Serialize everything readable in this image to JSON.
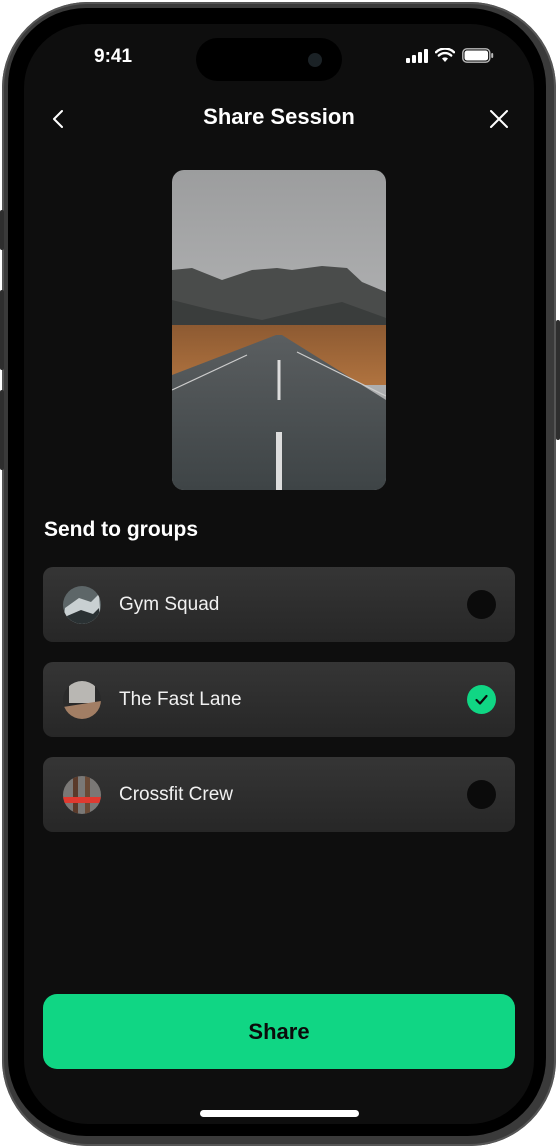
{
  "status_bar": {
    "time": "9:41",
    "icons": [
      "cellular-signal-icon",
      "wifi-icon",
      "battery-icon"
    ]
  },
  "nav": {
    "title": "Share Session",
    "back_icon": "chevron-left-icon",
    "close_icon": "close-icon"
  },
  "preview": {
    "description": "Road leading toward mountains under cloudy sky"
  },
  "groups_section": {
    "title": "Send to groups",
    "items": [
      {
        "name": "Gym Squad",
        "selected": false
      },
      {
        "name": "The Fast Lane",
        "selected": true
      },
      {
        "name": "Crossfit Crew",
        "selected": false
      }
    ]
  },
  "actions": {
    "share_label": "Share"
  },
  "colors": {
    "accent": "#10d684",
    "background": "#0e0e0e",
    "card": "#2e2e2e"
  }
}
